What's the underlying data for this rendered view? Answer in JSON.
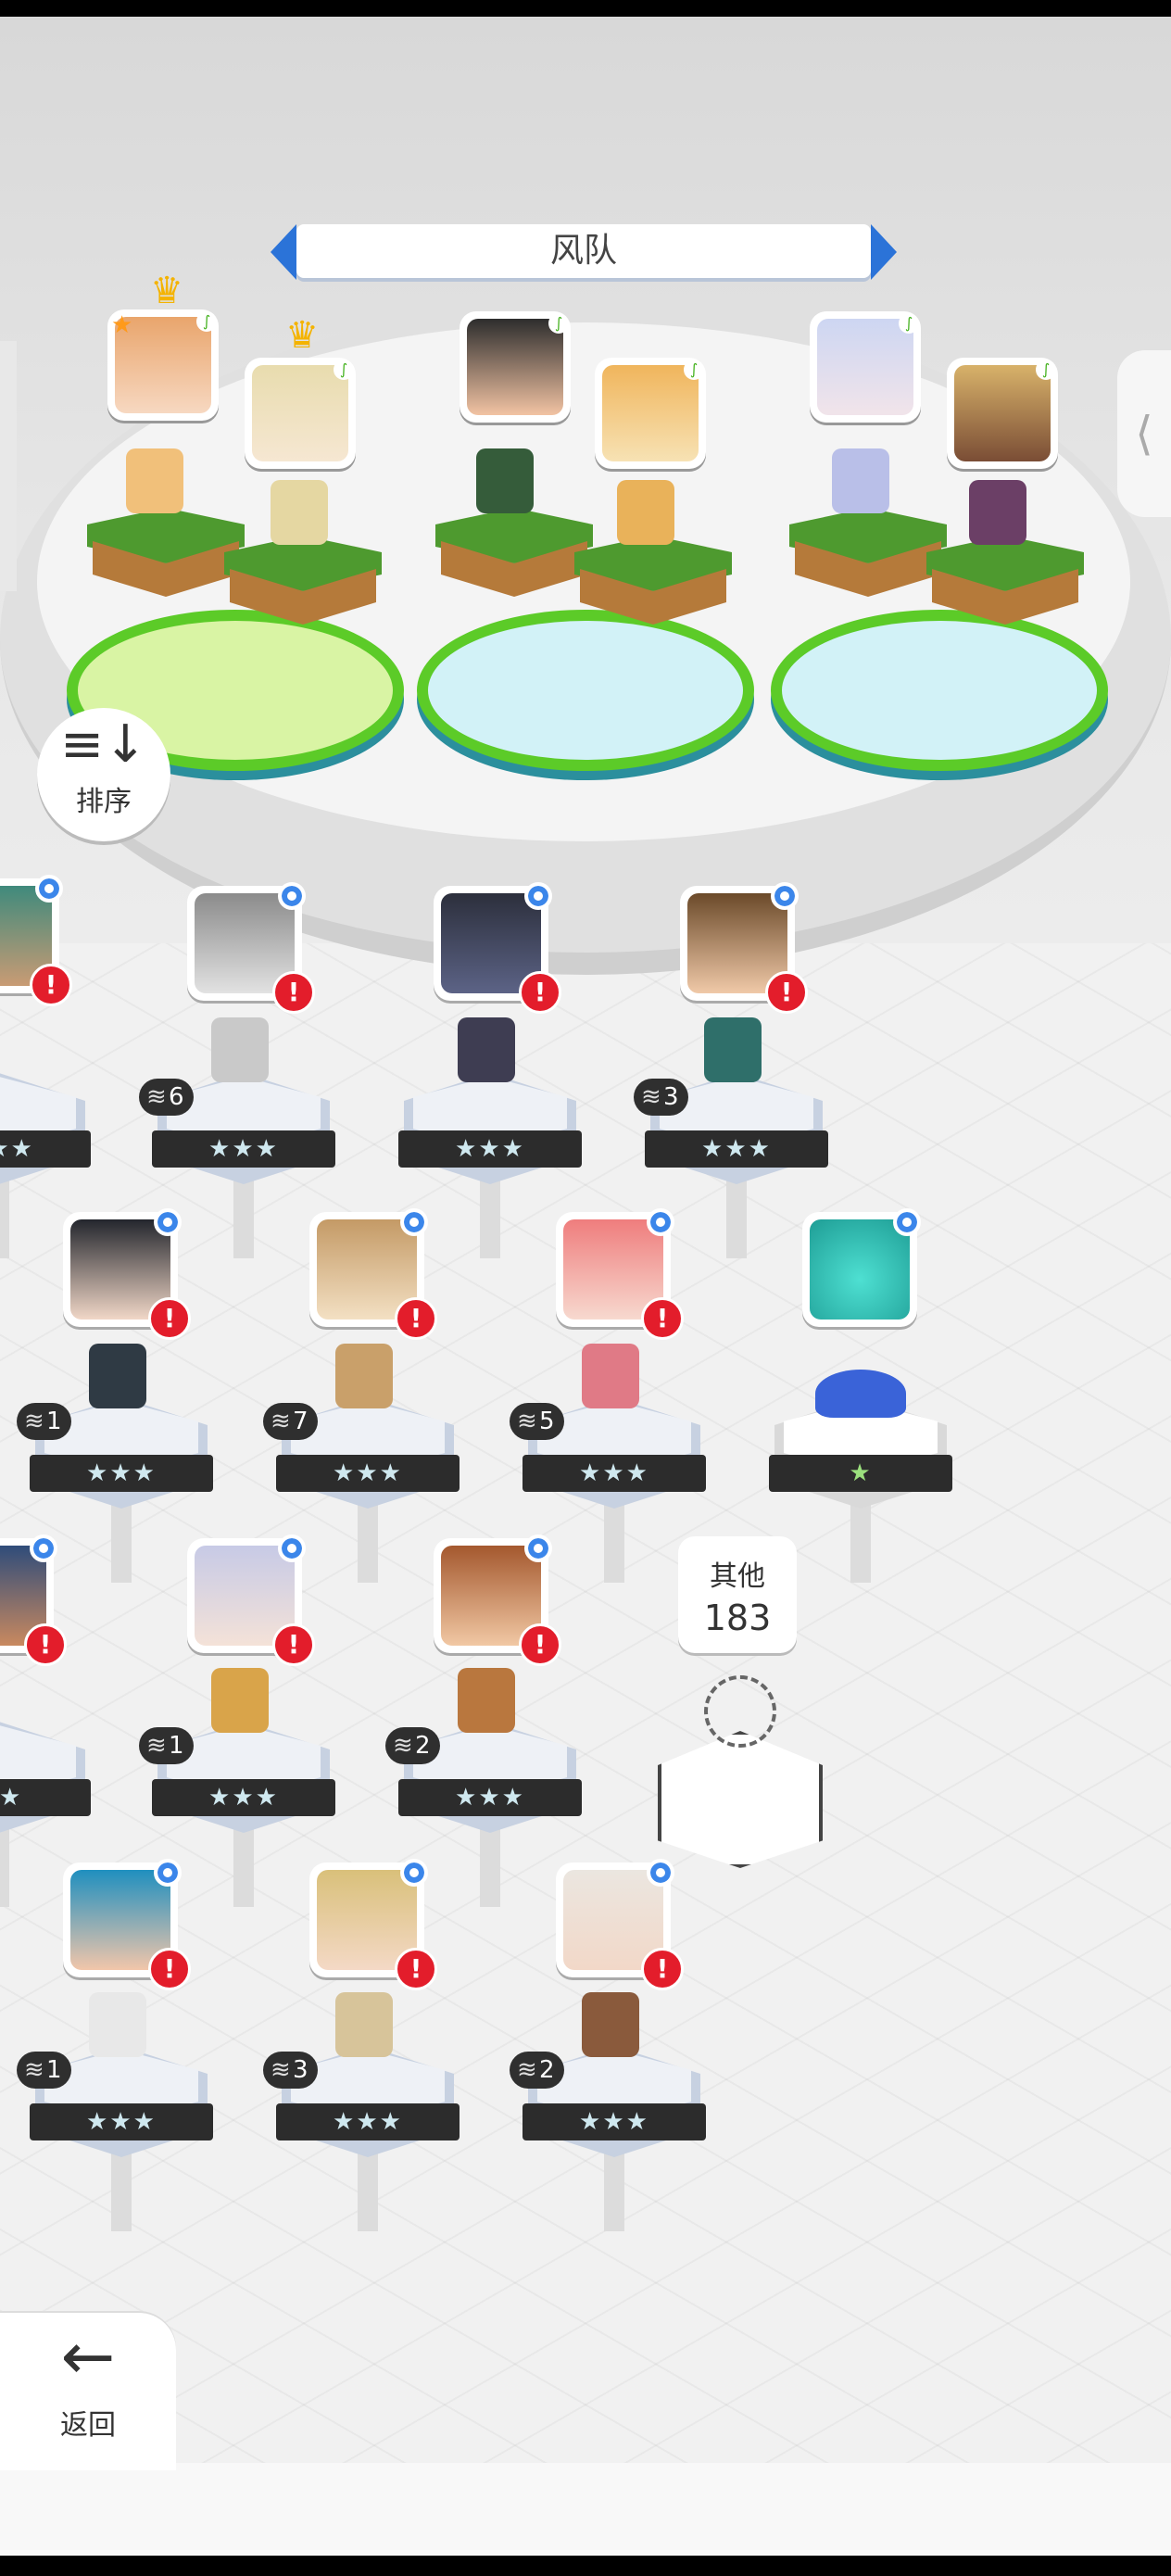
{
  "team": {
    "title": "风队"
  },
  "colors": {
    "accent": "#2b73d8",
    "alert": "#e31d2b",
    "badge": "#3b86ea",
    "grass": "#5ccb28"
  },
  "icons": {
    "sort": "≡↓",
    "back": "←",
    "star": "★",
    "leaf": "∫",
    "crown": "♛",
    "stack": "≋",
    "side_chevron": "⟨",
    "alert": "!"
  },
  "controls": {
    "sort_label": "排序",
    "back_label": "返回"
  },
  "other": {
    "label": "其他",
    "count": "183"
  },
  "formation": [
    {
      "slot": 1,
      "crown": true,
      "leader_star": true,
      "leaf": true
    },
    {
      "slot": 2,
      "crown": true,
      "leaf": true
    },
    {
      "slot": 3,
      "leaf": true
    },
    {
      "slot": 4,
      "leaf": true
    },
    {
      "slot": 5,
      "leaf": true
    },
    {
      "slot": 6,
      "leaf": true
    }
  ],
  "roster": [
    {
      "stars": "★★★",
      "count": "",
      "alert": true
    },
    {
      "stars": "★★★",
      "count": "6",
      "alert": true
    },
    {
      "stars": "★★★",
      "count": "",
      "alert": true
    },
    {
      "stars": "★★★",
      "count": "3",
      "alert": true
    },
    {
      "stars": "★★★",
      "count": "1",
      "alert": true
    },
    {
      "stars": "★★★",
      "count": "7",
      "alert": true
    },
    {
      "stars": "★★★",
      "count": "5",
      "alert": true
    },
    {
      "stars": "★",
      "count": "",
      "alert": false
    },
    {
      "stars": "★★",
      "count": "",
      "alert": true
    },
    {
      "stars": "★★★",
      "count": "1",
      "alert": true
    },
    {
      "stars": "★★★",
      "count": "2",
      "alert": true
    },
    {
      "stars": "★★★",
      "count": "1",
      "alert": true
    },
    {
      "stars": "★★★",
      "count": "3",
      "alert": true
    },
    {
      "stars": "★★★",
      "count": "2",
      "alert": true
    }
  ]
}
